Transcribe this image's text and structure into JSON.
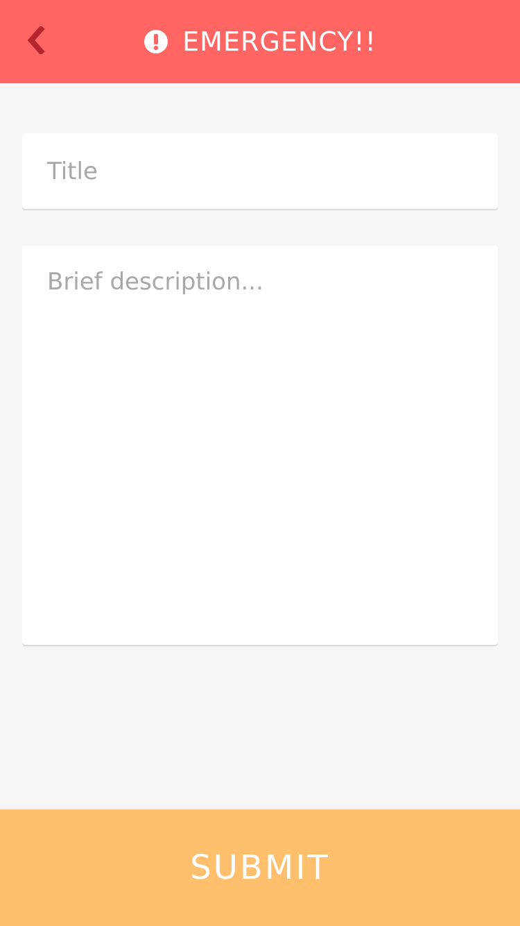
{
  "header": {
    "title": "EMERGENCY!!",
    "back_icon": "chevron-left-icon",
    "title_icon": "exclamation-circle-icon",
    "background_color": "#ff6663",
    "back_icon_color": "#b3262b"
  },
  "form": {
    "title_placeholder": "Title",
    "title_value": "",
    "description_placeholder": "Brief description...",
    "description_value": ""
  },
  "submit": {
    "label": "SUBMIT",
    "background_color": "#ffbf6c"
  }
}
